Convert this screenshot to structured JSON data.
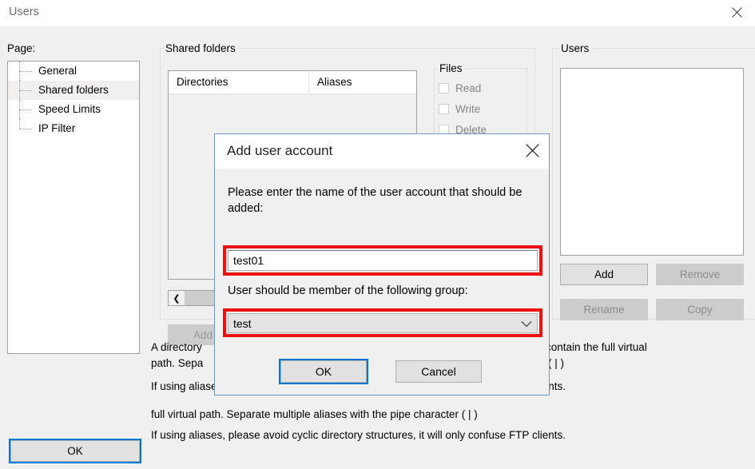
{
  "window": {
    "title": "Users",
    "close_icon": "close-icon"
  },
  "left_panel": {
    "label": "Page:",
    "items": [
      {
        "label": "General",
        "selected": false
      },
      {
        "label": "Shared folders",
        "selected": true
      },
      {
        "label": "Speed Limits",
        "selected": false
      },
      {
        "label": "IP Filter",
        "selected": false
      }
    ],
    "ok_label": "OK"
  },
  "shared_folders": {
    "group_label": "Shared folders",
    "columns": [
      "Directories",
      "Aliases"
    ],
    "rows": [],
    "scroll_left_icon": "chevron-left-icon",
    "add_label": "Add"
  },
  "files": {
    "group_label": "Files",
    "permissions": [
      {
        "label": "Read",
        "checked": false
      },
      {
        "label": "Write",
        "checked": false
      },
      {
        "label": "Delete",
        "checked": false
      }
    ]
  },
  "users": {
    "group_label": "Users",
    "items": [],
    "buttons": [
      {
        "label": "Add",
        "enabled": true
      },
      {
        "label": "Remove",
        "enabled": false
      },
      {
        "label": "Rename",
        "enabled": false
      },
      {
        "label": "Copy",
        "enabled": false
      }
    ]
  },
  "help_text": {
    "line1a": "A directory",
    "line1b": "contain the full virtual",
    "line2a": "path. Sepa",
    "line2b": "( | )",
    "line3": "If using aliases, please avoid cyclic directory structures, it will only confuse FTP clients.",
    "line4": "full virtual path. Separate multiple aliases with the pipe character ( | )",
    "line5": "If using aliases, please avoid cyclic directory structures, it will only confuse FTP clients."
  },
  "dialog": {
    "title": "Add user account",
    "close_icon": "close-icon",
    "prompt": "Please enter the name of the user account that should be added:",
    "name_input": {
      "value": "test01",
      "placeholder": ""
    },
    "group_label": "User should be member of the following group:",
    "group_select": {
      "value": "test",
      "caret_icon": "chevron-down-icon"
    },
    "ok_label": "OK",
    "cancel_label": "Cancel"
  },
  "colors": {
    "highlight_red": "#ee1111",
    "focus_blue": "#0078d7",
    "dialog_border": "#6d9bc3",
    "window_bg": "#f0f0f0"
  }
}
